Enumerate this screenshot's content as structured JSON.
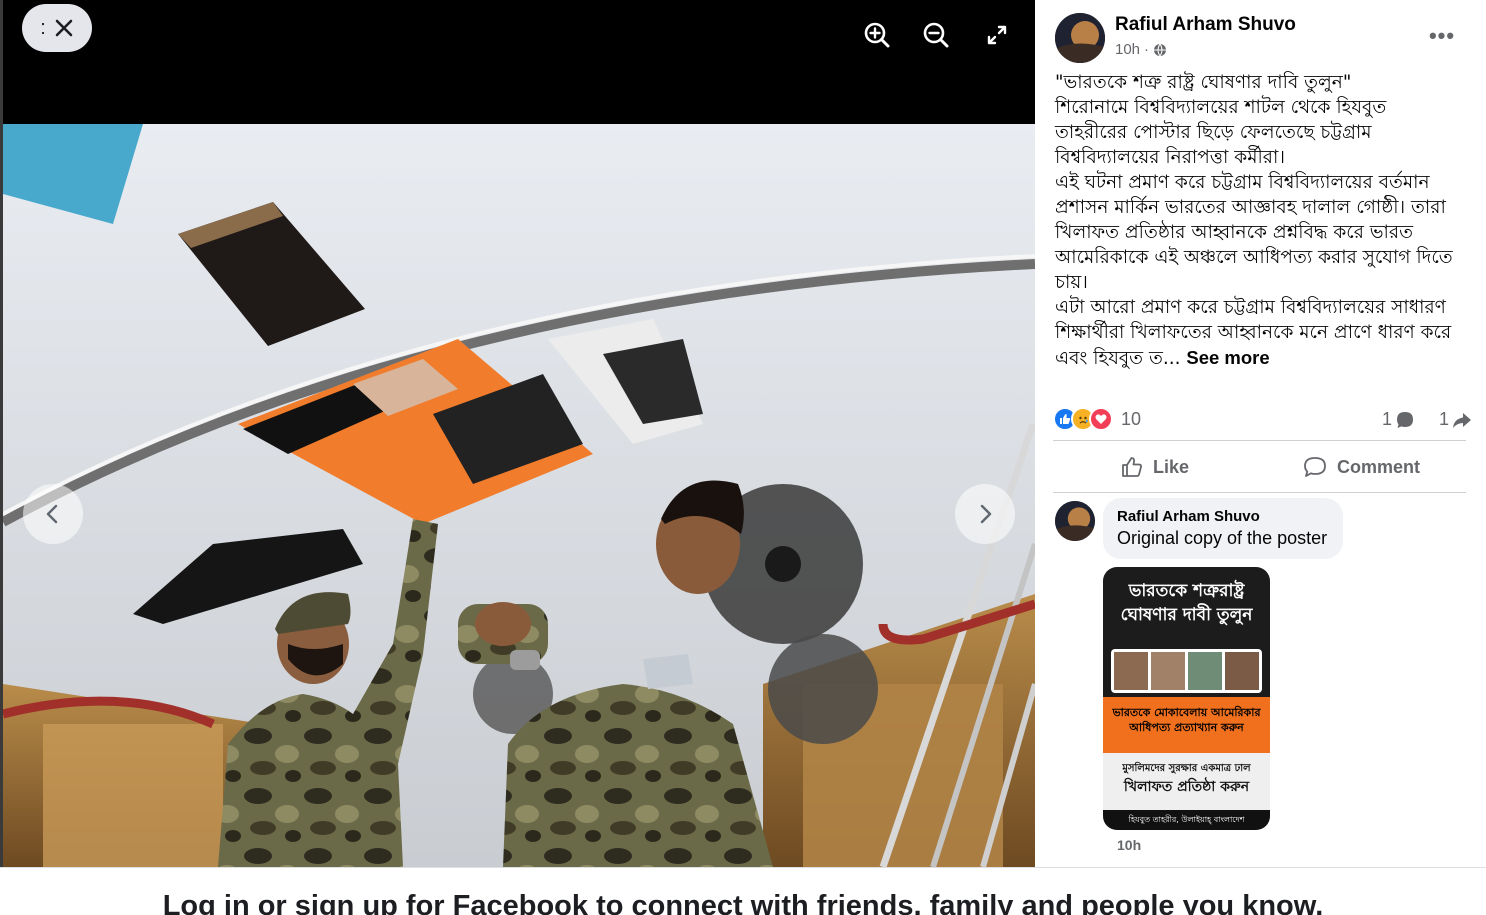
{
  "viewer": {
    "close_icon": "close-icon",
    "options_icon": "options-dots-icon",
    "zoom_in_icon": "zoom-in-icon",
    "zoom_out_icon": "zoom-out-icon",
    "fullscreen_icon": "fullscreen-icon",
    "prev_icon": "chevron-left-icon",
    "next_icon": "chevron-right-icon"
  },
  "post": {
    "author": "Rafiul Arham Shuvo",
    "time": "10h",
    "audience_icon": "globe-icon",
    "more_icon": "more-horizontal-icon",
    "text": [
      "\"ভারতকে শত্রু রাষ্ট্র ঘোষণার দাবি তুলুন\"",
      "শিরোনামে বিশ্ববিদ্যালয়ের শাটল থেকে হিযবুত",
      "তাহরীরের পোস্টার ছিড়ে ফেলতেছে চট্টগ্রাম",
      "বিশ্ববিদ্যালয়ের নিরাপত্তা কর্মীরা।",
      "এই ঘটনা প্রমাণ করে চট্টগ্রাম বিশ্ববিদ্যালয়ের বর্তমান",
      "প্রশাসন মার্কিন ভারতের আজ্ঞাবহ দালাল গোষ্ঠী। তারা",
      "খিলাফত প্রতিষ্ঠার আহ্বানকে প্রশ্নবিদ্ধ করে ভারত",
      "আমেরিকাকে এই অঞ্চলে আধিপত্য করার সুযোগ দিতে",
      "চায়।",
      "এটা আরো প্রমাণ করে চট্টগ্রাম বিশ্ববিদ্যালয়ের সাধারণ",
      "শিক্ষার্থীরা খিলাফতের আহ্বানকে মনে প্রাণে ধারণ করে"
    ],
    "truncated_line": "এবং হিযবুত ত...",
    "see_more": "See more",
    "reaction_count": "10",
    "comment_count": "1",
    "share_count": "1",
    "like_label": "Like",
    "comment_label": "Comment"
  },
  "comment": {
    "author": "Rafiul Arham Shuvo",
    "text": "Original copy of the poster",
    "time": "10h",
    "poster": {
      "title_line1": "ভারতকে শত্রুরাষ্ট্র",
      "title_line2": "ঘোষণার দাবী তুলুন",
      "orange_line1": "ভারতকে মোকাবেলায় আমেরিকার",
      "orange_line2": "আধিপত্য প্রত্যাখ্যান করুন",
      "light_line1": "মুসলিমদের সুরক্ষার একমাত্র ঢাল",
      "light_line2": "খিলাফত প্রতিষ্ঠা করুন",
      "footer": "হিযবুত তাহরীর, উলাইয়াহ্ বাংলাদেশ"
    }
  },
  "banner": {
    "text": "Log in or sign up for Facebook to connect with friends, family and people you know."
  },
  "colors": {
    "like_blue": "#1877f2",
    "love_red": "#f33e58",
    "sad_yellow": "#f7b125",
    "poster_orange": "#f0701e"
  }
}
